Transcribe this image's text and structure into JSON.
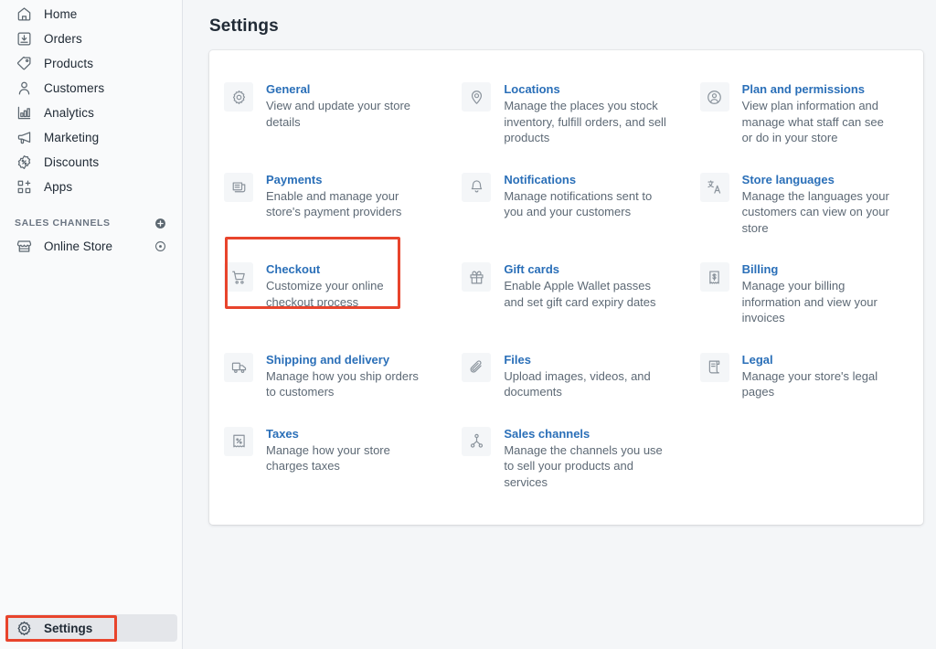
{
  "sidebar": {
    "nav_items": [
      {
        "label": "Home",
        "icon": "home-icon"
      },
      {
        "label": "Orders",
        "icon": "orders-inbox-icon"
      },
      {
        "label": "Products",
        "icon": "products-tag-icon"
      },
      {
        "label": "Customers",
        "icon": "customers-person-icon"
      },
      {
        "label": "Analytics",
        "icon": "analytics-bar-chart-icon"
      },
      {
        "label": "Marketing",
        "icon": "marketing-megaphone-icon"
      },
      {
        "label": "Discounts",
        "icon": "discounts-percent-badge-icon"
      },
      {
        "label": "Apps",
        "icon": "apps-grid-plus-icon"
      }
    ],
    "sales_channels": {
      "section_title": "SALES CHANNELS",
      "add_icon": "plus-circle-icon",
      "items": [
        {
          "label": "Online Store",
          "icon": "store-front-icon",
          "action_icon": "eye-icon"
        }
      ]
    },
    "settings": {
      "label": "Settings",
      "icon": "gear-icon",
      "selected": true
    }
  },
  "main": {
    "page_title": "Settings",
    "settings_items": [
      {
        "title": "General",
        "desc": "View and update your store details",
        "icon": "gear-icon",
        "column": 1
      },
      {
        "title": "Locations",
        "desc": "Manage the places you stock inventory, fulfill orders, and sell products",
        "icon": "location-pin-icon",
        "column": 2
      },
      {
        "title": "Plan and permissions",
        "desc": "View plan information and manage what staff can see or do in your store",
        "icon": "person-circle-icon",
        "column": 3
      },
      {
        "title": "Payments",
        "desc": "Enable and manage your store's payment providers",
        "icon": "payment-card-icon",
        "column": 1
      },
      {
        "title": "Notifications",
        "desc": "Manage notifications sent to you and your customers",
        "icon": "bell-icon",
        "column": 2
      },
      {
        "title": "Store languages",
        "desc": "Manage the languages your customers can view on your store",
        "icon": "translate-icon",
        "column": 3
      },
      {
        "title": "Checkout",
        "desc": "Customize your online checkout process",
        "icon": "shopping-cart-icon",
        "column": 1,
        "highlighted": true
      },
      {
        "title": "Gift cards",
        "desc": "Enable Apple Wallet passes and set gift card expiry dates",
        "icon": "gift-icon",
        "column": 2
      },
      {
        "title": "Billing",
        "desc": "Manage your billing information and view your invoices",
        "icon": "receipt-dollar-icon",
        "column": 3
      },
      {
        "title": "Shipping and delivery",
        "desc": "Manage how you ship orders to customers",
        "icon": "delivery-truck-icon",
        "column": 1
      },
      {
        "title": "Files",
        "desc": "Upload images, videos, and documents",
        "icon": "paperclip-icon",
        "column": 2
      },
      {
        "title": "Legal",
        "desc": "Manage your store's legal pages",
        "icon": "legal-scroll-icon",
        "column": 3
      },
      {
        "title": "Taxes",
        "desc": "Manage how your store charges taxes",
        "icon": "tax-percent-icon",
        "column": 1
      },
      {
        "title": "Sales channels",
        "desc": "Manage the channels you use to sell your products and services",
        "icon": "sales-channels-node-icon",
        "column": 2
      }
    ]
  },
  "colors": {
    "link_blue": "#2a6fb8",
    "body_text": "#212b36",
    "muted_text": "#5d6975",
    "page_bg": "#f4f6f8",
    "sidebar_bg": "#f9fafb",
    "card_bg": "#ffffff",
    "highlight_red": "#e8442c",
    "selected_row_bg": "#e4e6ea"
  },
  "annotations": [
    {
      "name": "checkout-highlight",
      "target": "Checkout",
      "color": "#e8442c"
    },
    {
      "name": "settings-highlight",
      "target": "Settings",
      "color": "#e8442c"
    }
  ]
}
